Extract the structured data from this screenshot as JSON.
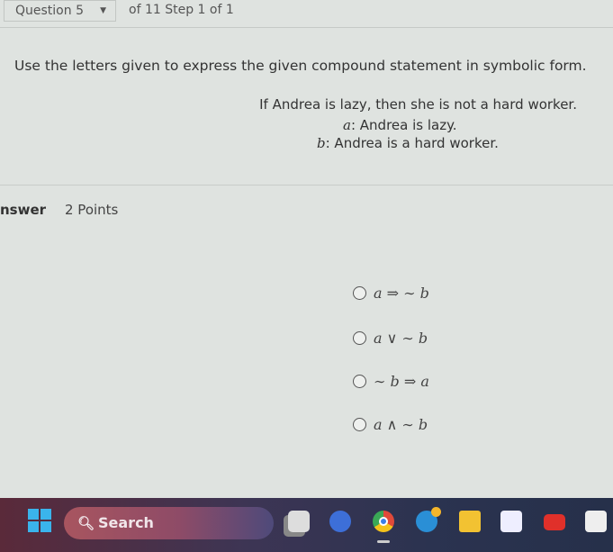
{
  "header": {
    "question_label": "Question 5",
    "question_total": "of 11 Step 1 of 1"
  },
  "prompt": "Use the letters given to express the given compound statement in symbolic form.",
  "statement": "If Andrea is lazy, then she is not a hard worker.",
  "definitions": [
    {
      "var": "a",
      "text": ": Andrea is lazy."
    },
    {
      "var": "b",
      "text": ": Andrea is a hard worker."
    }
  ],
  "answer": {
    "label": "nswer",
    "points": "2 Points"
  },
  "options": [
    "a ⇒ ∼ b",
    "a ∨ ∼ b",
    "∼ b ⇒ a",
    "a ∧ ∼ b"
  ],
  "taskbar": {
    "search_label": "Search",
    "icons": [
      "windows-start-icon",
      "task-view-icon",
      "meet-icon",
      "chrome-icon",
      "help-icon",
      "file-explorer-icon",
      "store-icon",
      "youtube-icon",
      "app-icon"
    ]
  }
}
